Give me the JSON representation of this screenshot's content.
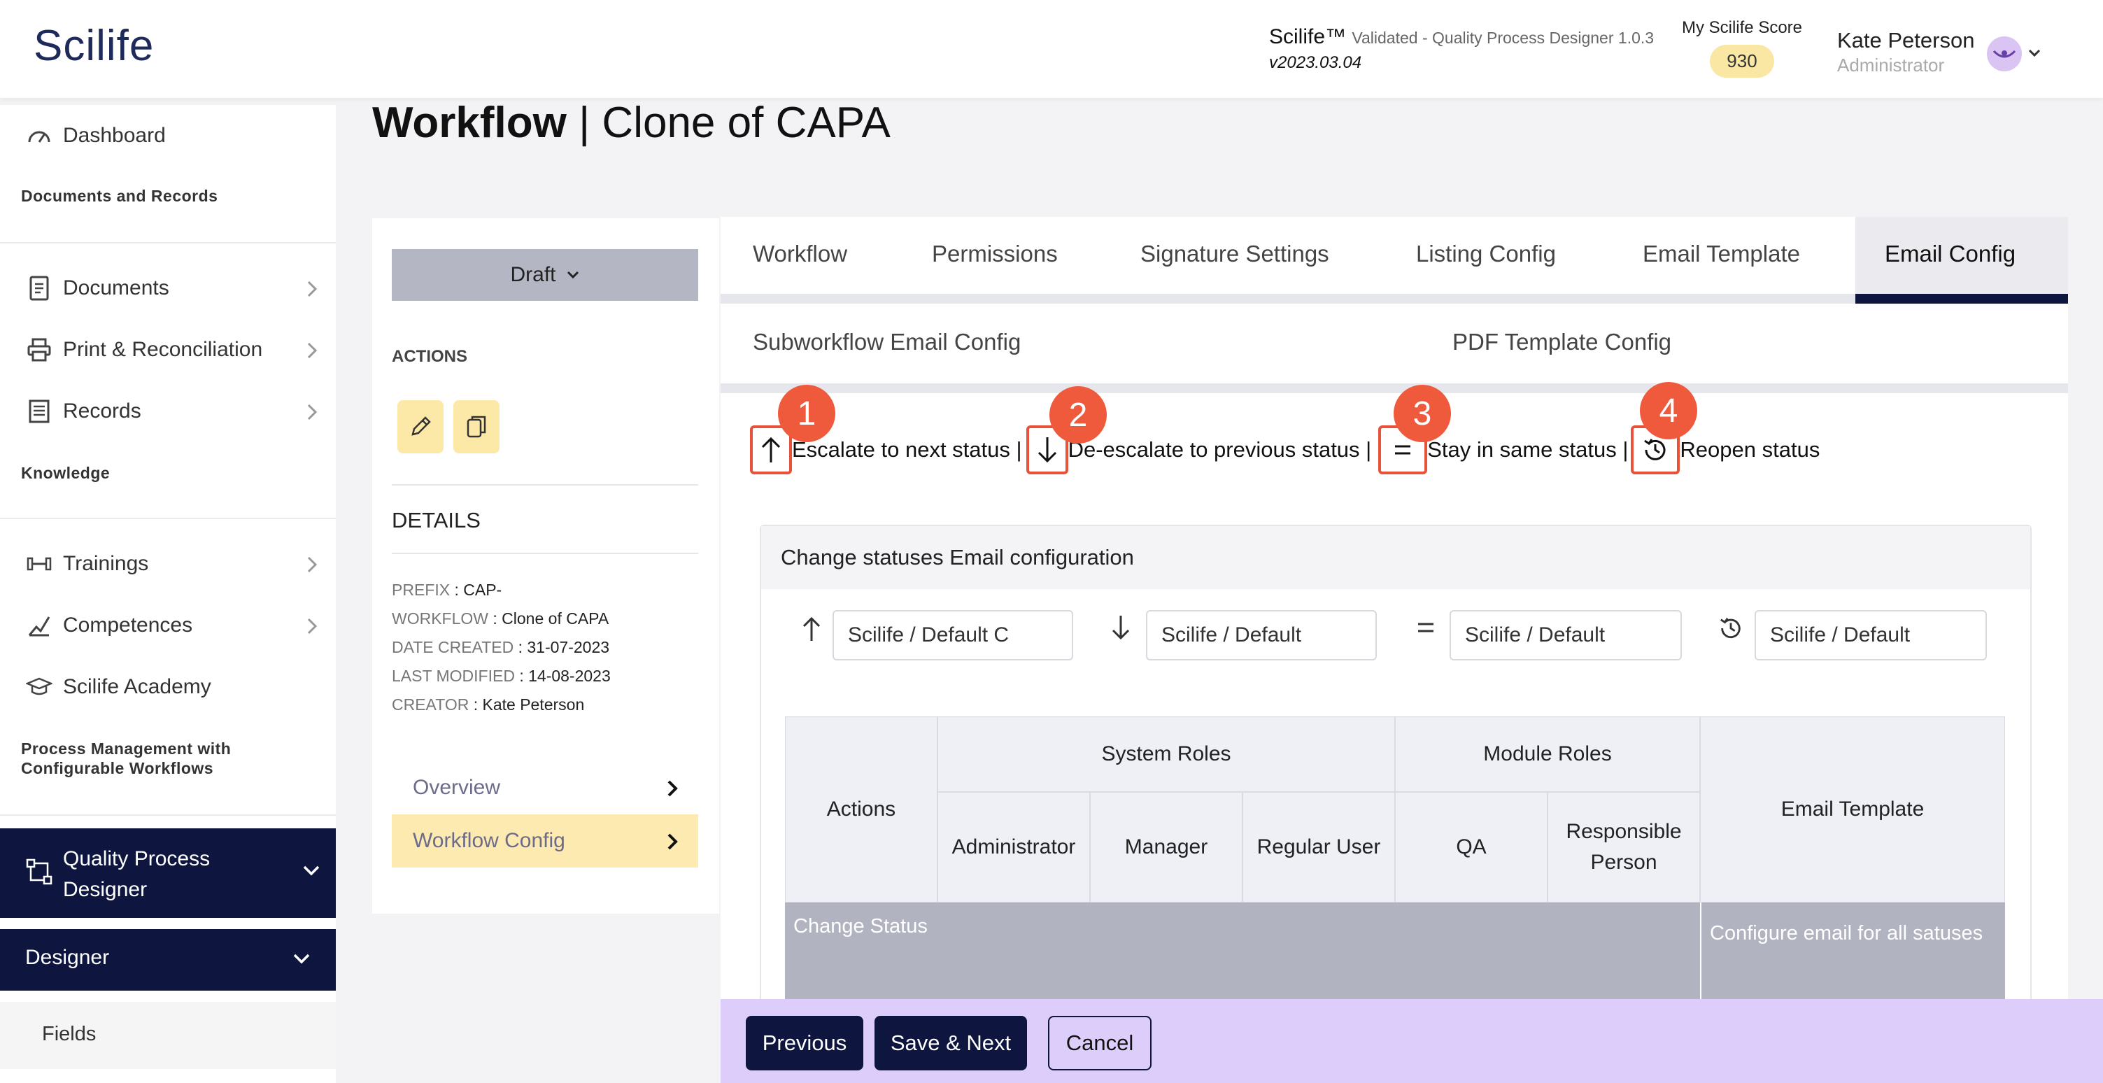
{
  "header": {
    "logo": "Scilife",
    "product_name": "Scilife™",
    "product_desc": "Validated - Quality Process Designer 1.0.3",
    "version": "v2023.03.04",
    "score_label": "My Scilife Score",
    "score_value": "930",
    "user_name": "Kate Peterson",
    "user_role": "Administrator",
    "avatar_icon": "eye-avatar-icon"
  },
  "sidebar": {
    "dashboard": "Dashboard",
    "section_docs": "Documents and Records",
    "documents": "Documents",
    "print": "Print & Reconciliation",
    "records": "Records",
    "section_knowledge": "Knowledge",
    "trainings": "Trainings",
    "competences": "Competences",
    "academy": "Scilife Academy",
    "section_process": "Process Management with Configurable Workflows",
    "qpd": "Quality Process Designer",
    "designer": "Designer",
    "fields": "Fields"
  },
  "page": {
    "title_bold": "Workflow",
    "title_sep": " | ",
    "title_rest": "Clone of CAPA"
  },
  "left_panel": {
    "status": "Draft",
    "actions_label": "ACTIONS",
    "details_label": "DETAILS",
    "details": [
      {
        "k": "PREFIX",
        "v": "CAP-"
      },
      {
        "k": "WORKFLOW",
        "v": "Clone of CAPA"
      },
      {
        "k": "DATE CREATED",
        "v": "31-07-2023"
      },
      {
        "k": "LAST MODIFIED",
        "v": "14-08-2023"
      },
      {
        "k": "CREATOR",
        "v": "Kate Peterson"
      }
    ],
    "nav_overview": "Overview",
    "nav_workflow_config": "Workflow Config"
  },
  "tabs": [
    "Workflow",
    "Permissions",
    "Signature Settings",
    "Listing Config",
    "Email Template",
    "Email Config"
  ],
  "subtabs": [
    "Subworkflow Email Config",
    "PDF Template Config"
  ],
  "legend": {
    "escalate": "Escalate to next status |",
    "deescalate": "De-escalate to previous status |",
    "stay": "Stay in same status |",
    "reopen": "Reopen status",
    "markers": [
      "1",
      "2",
      "3",
      "4"
    ]
  },
  "config": {
    "title": "Change statuses Email configuration",
    "selects": [
      "Scilife / Default C",
      "Scilife / Default",
      "Scilife / Default",
      "Scilife / Default"
    ]
  },
  "table": {
    "actions": "Actions",
    "system_roles": "System Roles",
    "module_roles": "Module Roles",
    "email_template": "Email Template",
    "administrator": "Administrator",
    "manager": "Manager",
    "regular_user": "Regular User",
    "qa": "QA",
    "responsible": "Responsible Person",
    "row_change_status": "Change Status",
    "row_configure": "Configure email for all satuses"
  },
  "footer": {
    "previous": "Previous",
    "save_next": "Save & Next",
    "cancel": "Cancel"
  },
  "colors": {
    "navy": "#0e1640",
    "marker": "#ef5a3c",
    "action_yellow": "#fde9a7",
    "footer_purple": "#dccdfb"
  }
}
